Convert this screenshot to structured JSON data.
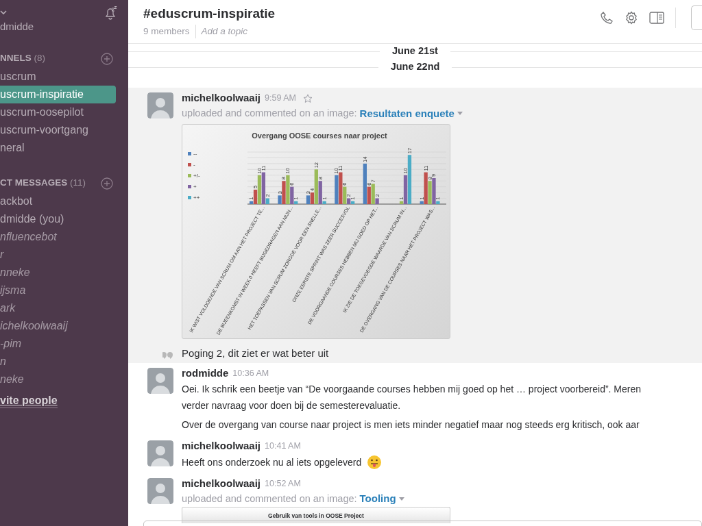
{
  "sidebar": {
    "user": "dmidde",
    "channels": {
      "heading": "NNELS",
      "count": "(8)",
      "items": [
        {
          "label": "uscrum",
          "selected": false
        },
        {
          "label": "uscrum-inspiratie",
          "selected": true
        },
        {
          "label": "uscrum-oosepilot",
          "selected": false
        },
        {
          "label": "uscrum-voortgang",
          "selected": false
        },
        {
          "label": "neral",
          "selected": false
        }
      ]
    },
    "direct_messages": {
      "heading": "CT MESSAGES",
      "count": "(11)",
      "items": [
        {
          "label": "ackbot",
          "online": true
        },
        {
          "label": "dmidde (you)",
          "online": true
        },
        {
          "label": "nfluencebot",
          "online": false
        },
        {
          "label": "r",
          "online": false
        },
        {
          "label": "nneke",
          "online": false
        },
        {
          "label": "ijsma",
          "online": false
        },
        {
          "label": "ark",
          "online": false
        },
        {
          "label": "ichelkoolwaaij",
          "online": false
        },
        {
          "label": "-pim",
          "online": false
        },
        {
          "label": "n",
          "online": false
        },
        {
          "label": "neke",
          "online": false
        }
      ]
    },
    "invite": "vite people"
  },
  "header": {
    "title": "#eduscrum-inspiratie",
    "members": "9 members",
    "topic_placeholder": "Add a topic"
  },
  "date_dividers": [
    "June 21st",
    "June 22nd"
  ],
  "messages": [
    {
      "author": "michelkoolwaaij",
      "time": "9:59 AM",
      "highlighted": true,
      "starred": false,
      "kind": "upload",
      "prefix": "uploaded and commented on an image:",
      "link": "Resultaten enquete",
      "chart_data": {
        "type": "bar",
        "title": "Overgang OOSE courses naar project",
        "categories": [
          "IK WIST VOLDOENDE VAN SCRUM OM AAN HET PROJECT TE...",
          "DE BIJEENKOMST IN WEEK 0 HEEFT BIJGEDRAGEN AAN MIJN...",
          "HET TOEPASSEN  VAN SCRUM ZORGDE VOOR EEN SNELLE...",
          "ONZE EERSTE  SPRINT WAS ZEER SUCCESVOL",
          "DE VOORGAANDE COURSES HEBBEN MIJ GOED OP HET...",
          "IK ZIE DE TOEGEVOEGDE  WAARDE VAN SCRUM IN...",
          "DE OVERGANG VAN DE COURSES NAAR HET PROJECT WAS..."
        ],
        "data_labels": true,
        "legend": "left",
        "series": [
          {
            "name": "--",
            "color": "#4f81bd",
            "values": [
              1,
              3,
              3,
              10,
              14,
              null,
              1
            ]
          },
          {
            "name": "-",
            "color": "#c0504d",
            "values": [
              5,
              8,
              4,
              11,
              6,
              null,
              11
            ]
          },
          {
            "name": "+/-",
            "color": "#9bbb59",
            "values": [
              10,
              10,
              12,
              6,
              7,
              1,
              8
            ]
          },
          {
            "name": "+",
            "color": "#8064a2",
            "values": [
              11,
              6,
              8,
              2,
              2,
              10,
              9
            ]
          },
          {
            "name": "++",
            "color": "#4bacc6",
            "values": [
              2,
              1,
              1,
              1,
              null,
              17,
              1
            ]
          }
        ]
      },
      "comment": "Poging 2, dit ziet er wat beter uit"
    },
    {
      "author": "rodmidde",
      "time": "10:36 AM",
      "highlighted": false,
      "kind": "text",
      "paragraphs": [
        "Oei. Ik schrik een beetje van “De voorgaande courses hebben mij goed op het … project voorbereid”. Meren\nverder navraag voor doen bij de semesterevaluatie.",
        "Over de overgang van course naar project is men iets minder negatief maar nog steeds erg kritisch, ook aar"
      ]
    },
    {
      "author": "michelkoolwaaij",
      "time": "10:41 AM",
      "highlighted": false,
      "kind": "text",
      "paragraphs": [
        "Heeft ons onderzoek nu al iets opgeleverd"
      ],
      "emoji": true
    },
    {
      "author": "michelkoolwaaij",
      "time": "10:52 AM",
      "highlighted": false,
      "kind": "upload",
      "prefix": "uploaded and commented on an image:",
      "link": "Tooling",
      "image_title": "Gebruik van tools in OOSE Project"
    }
  ]
}
